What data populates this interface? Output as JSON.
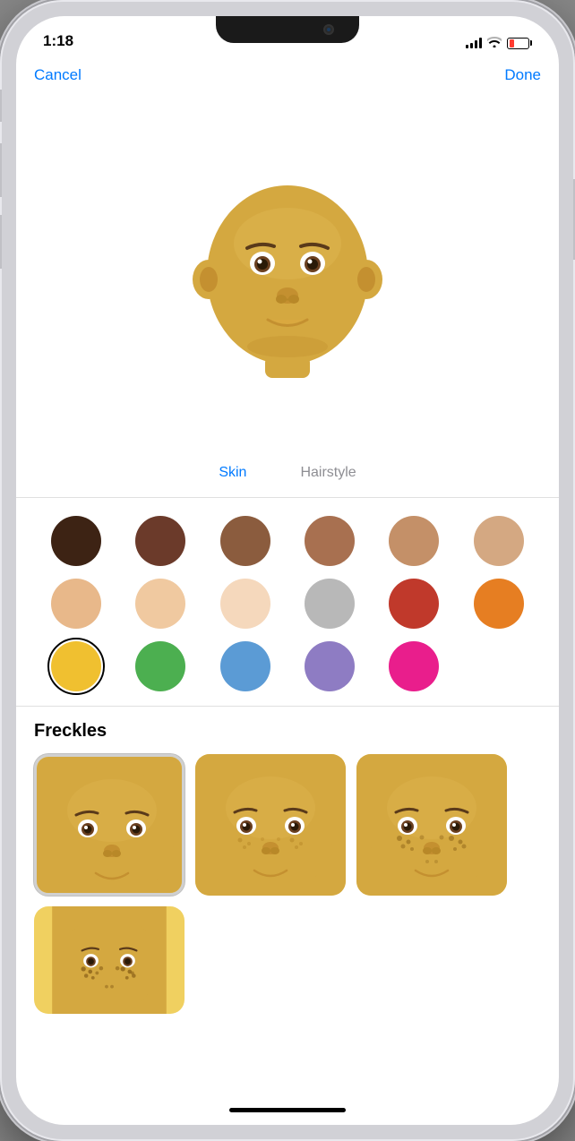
{
  "statusBar": {
    "time": "1:18",
    "signalDots": "●●●●",
    "wifiLabel": "wifi",
    "batteryLabel": "battery"
  },
  "nav": {
    "cancelLabel": "Cancel",
    "doneLabel": "Done"
  },
  "tabs": [
    {
      "id": "skin",
      "label": "Skin",
      "active": true
    },
    {
      "id": "hairstyle",
      "label": "Hairstyle",
      "active": false
    }
  ],
  "skinColors": [
    [
      "#3d2314",
      "#6b3a2a",
      "#8b5c3e",
      "#a87050",
      "#c49068",
      "#d4a882"
    ],
    [
      "#e8b88a",
      "#f0c9a0",
      "#f5d8bc",
      "#b8b8b8",
      "#c0392b",
      "#e67e22"
    ],
    [
      "#f0c030",
      "#4caf50",
      "#5b9bd5",
      "#8e7cc3",
      "#e91e8c",
      null
    ]
  ],
  "selectedColorIndex": [
    2,
    0
  ],
  "freckles": {
    "title": "Freckles",
    "options": [
      {
        "id": "none",
        "label": "No freckles",
        "selected": true
      },
      {
        "id": "light",
        "label": "Light freckles",
        "selected": false
      },
      {
        "id": "medium",
        "label": "Medium freckles",
        "selected": false
      },
      {
        "id": "heavy",
        "label": "Heavy freckles",
        "selected": false
      }
    ]
  },
  "icons": {
    "wifi": "wifi-icon",
    "battery": "battery-icon",
    "signal": "signal-icon"
  }
}
